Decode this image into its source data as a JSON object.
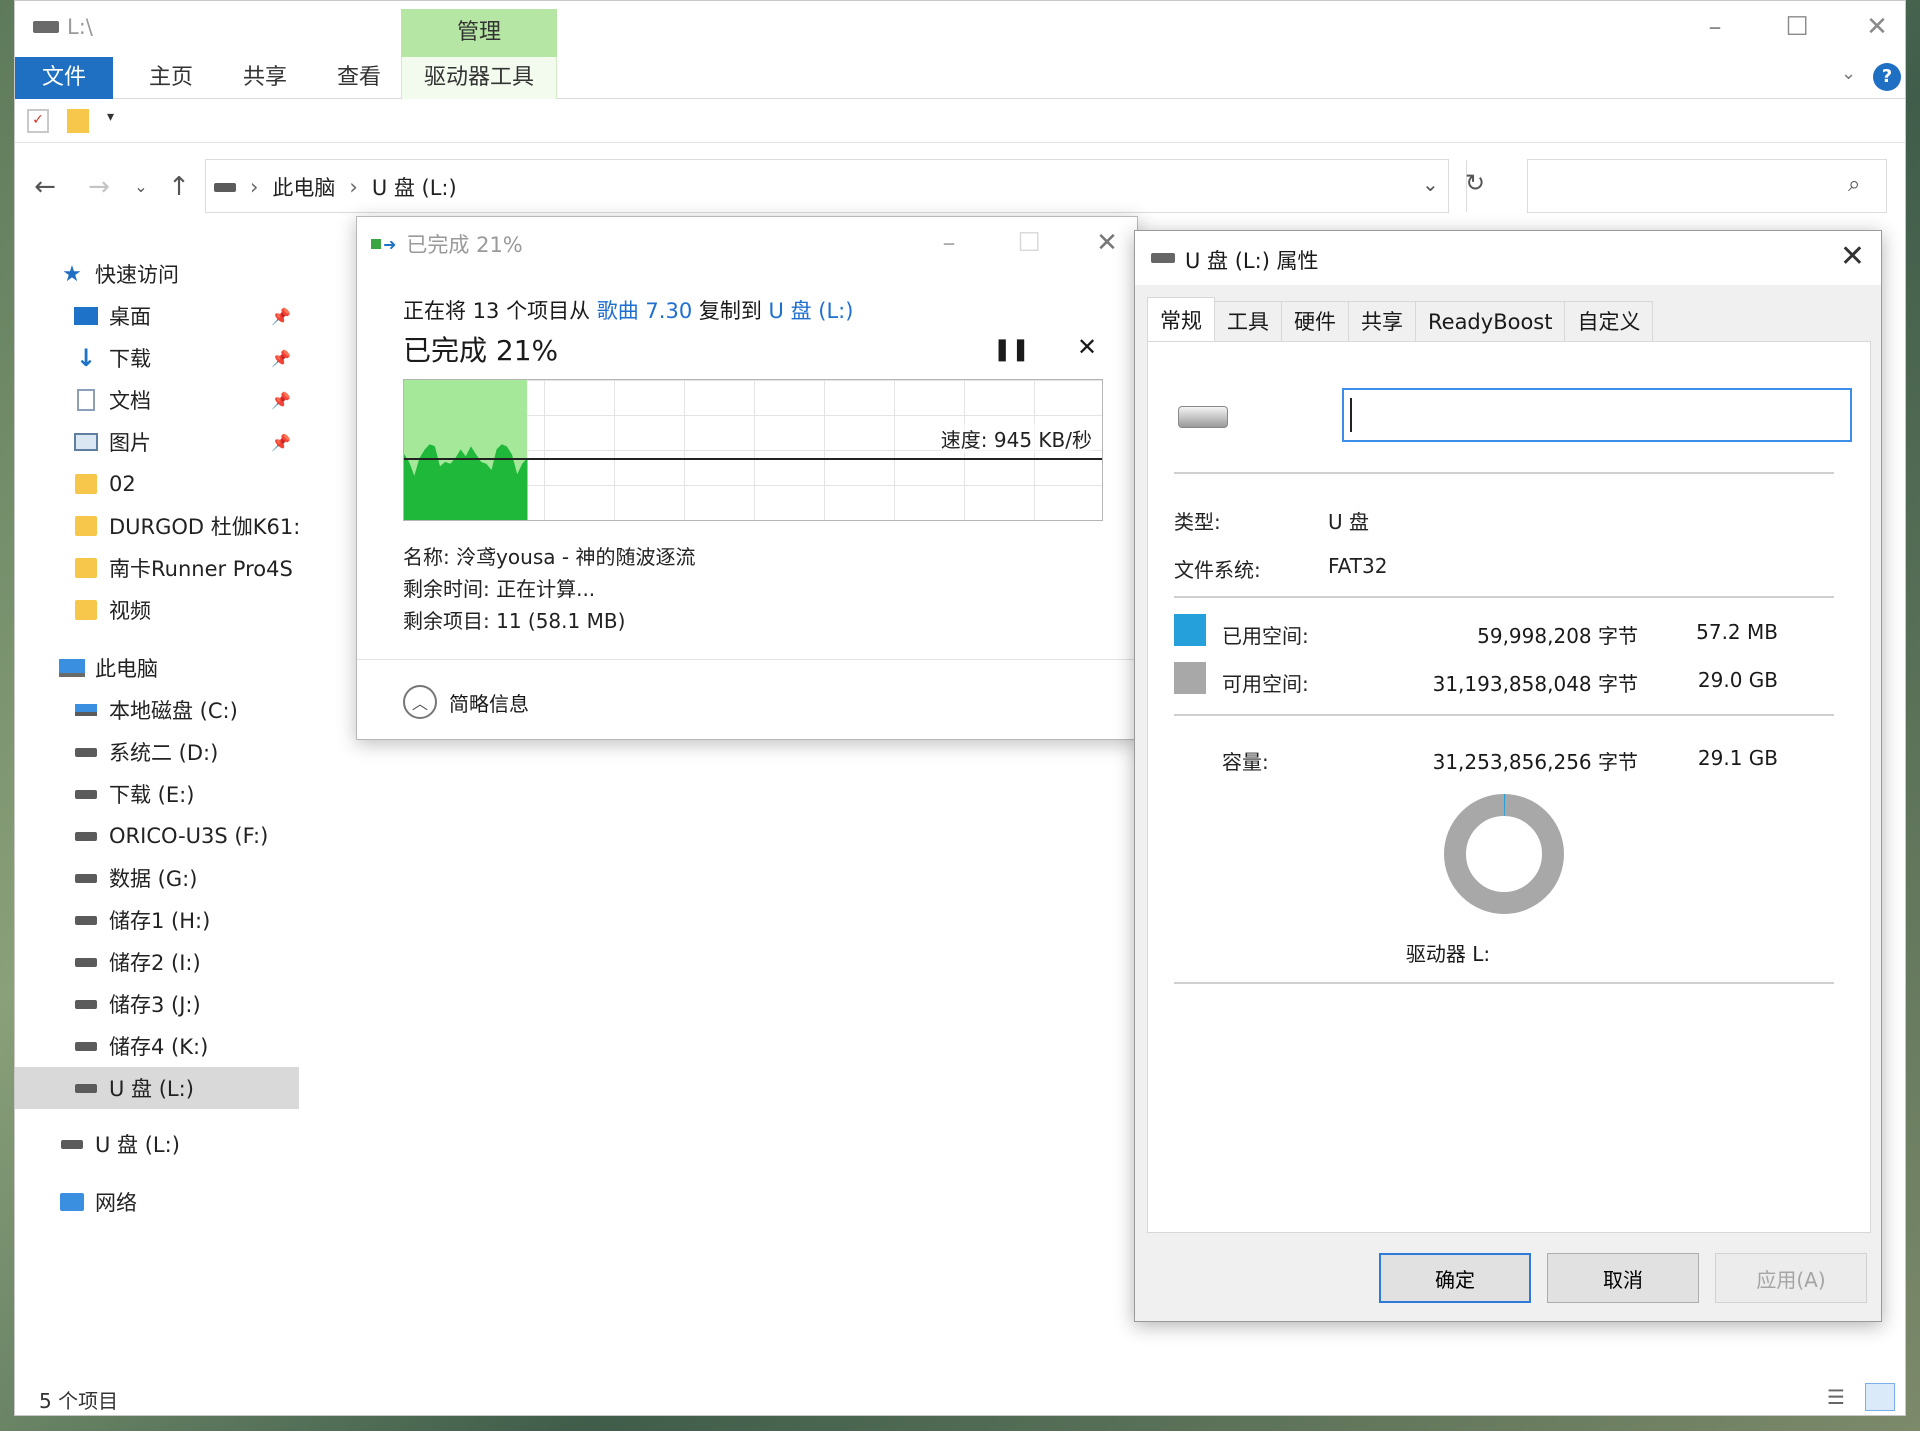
{
  "explorer": {
    "title": "L:\\",
    "ribbon": {
      "tabs": [
        "文件",
        "主页",
        "共享",
        "查看",
        "驱动器工具"
      ],
      "manage_header": "管理"
    },
    "address": {
      "crumbs": [
        "此电脑",
        "U 盘 (L:)"
      ]
    },
    "sidebar": {
      "quick_access": "快速访问",
      "quick_items": [
        "桌面",
        "下载",
        "文档",
        "图片",
        "02",
        "DURGOD 杜伽K61:",
        "南卡Runner Pro4S",
        "视频"
      ],
      "this_pc": "此电脑",
      "drives": [
        "本地磁盘 (C:)",
        "系统二 (D:)",
        "下载 (E:)",
        "ORICO-U3S (F:)",
        "数据 (G:)",
        "储存1 (H:)",
        "储存2 (I:)",
        "储存3 (J:)",
        "储存4 (K:)",
        "U 盘 (L:)"
      ],
      "usb": "U 盘 (L:)",
      "network": "网络"
    },
    "status": "5 个项目"
  },
  "copy": {
    "title": "已完成 21%",
    "line1_prefix": "正在将 13 个项目从 ",
    "line1_src": "歌曲 7.30",
    "line1_mid": " 复制到 ",
    "line1_dst": "U 盘 (L:)",
    "percent": "已完成 21%",
    "progress": 0.21,
    "speed": "速度: 945 KB/秒",
    "name": "名称: 泠鸢yousa - 神的随波逐流",
    "time_left": "剩余时间: 正在计算...",
    "items_left": "剩余项目: 11 (58.1 MB)",
    "more_info": "简略信息",
    "colors": {
      "progress_fill": "#a6e89a",
      "throughput": "#1fb83a"
    }
  },
  "props": {
    "title": "U 盘 (L:) 属性",
    "tabs": [
      "常规",
      "工具",
      "硬件",
      "共享",
      "ReadyBoost",
      "自定义"
    ],
    "type_label": "类型:",
    "type_value": "U 盘",
    "fs_label": "文件系统:",
    "fs_value": "FAT32",
    "used_label": "已用空间:",
    "used_bytes": "59,998,208 字节",
    "used_size": "57.2 MB",
    "free_label": "可用空间:",
    "free_bytes": "31,193,858,048 字节",
    "free_size": "29.0 GB",
    "cap_label": "容量:",
    "cap_bytes": "31,253,856,256 字节",
    "cap_size": "29.1 GB",
    "drive_label": "驱动器 L:",
    "used_fraction": 0.0019,
    "colors": {
      "used": "#26a0da",
      "free": "#a8a8a8"
    },
    "buttons": {
      "ok": "确定",
      "cancel": "取消",
      "apply": "应用(A)"
    }
  }
}
